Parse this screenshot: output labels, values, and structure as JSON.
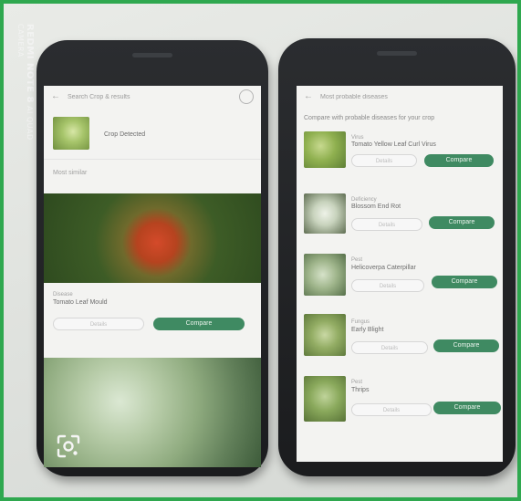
{
  "watermark": {
    "brand": "REDMI NOTE 8",
    "line": "AI QUAD CAMERA"
  },
  "left_phone": {
    "appbar_title": "Search Crop & results",
    "top_result_name": "Crop Detected",
    "section_label": "Most similar",
    "card_small": "Disease",
    "card_name": "Tomato Leaf Mould",
    "details_button": "Details",
    "compare_button": "Compare"
  },
  "right_phone": {
    "appbar_title": "Most probable diseases",
    "intro": "Compare with probable diseases for your crop",
    "items": [
      {
        "small": "Virus",
        "name": "Tomato Yellow Leaf Curl Virus",
        "details": "Details",
        "compare": "Compare"
      },
      {
        "small": "Deficiency",
        "name": "Blossom End Rot",
        "details": "Details",
        "compare": "Compare"
      },
      {
        "small": "Pest",
        "name": "Helicoverpa Caterpillar",
        "details": "Details",
        "compare": "Compare"
      },
      {
        "small": "Fungus",
        "name": "Early Blight",
        "details": "Details",
        "compare": "Compare"
      },
      {
        "small": "Pest",
        "name": "Thrips",
        "details": "Details",
        "compare": "Compare"
      }
    ]
  },
  "overlay": {
    "icon": "lens-icon"
  },
  "colors": {
    "accent": "#3f8a62",
    "frame": "#2fa84f"
  }
}
